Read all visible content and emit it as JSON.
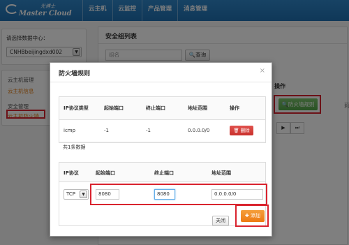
{
  "brand": {
    "cn": "光博士",
    "en": "Master Cloud"
  },
  "nav": [
    "云主机",
    "云监控",
    "产品管理",
    "消息管理"
  ],
  "sidebar": {
    "dc_label": "请选择数据中心：",
    "dc_value": "CNHBbeijingdxd002",
    "groups": [
      {
        "head": "云主机管理",
        "item": "云主机信息"
      },
      {
        "head": "安全管理",
        "item": "云主机防火墙"
      }
    ]
  },
  "main": {
    "title": "安全组列表",
    "search_placeholder": "组名",
    "search_button": "查询",
    "op_header": "操作",
    "firewall_button": "防火墙规则",
    "more_glyph": "莉",
    "pager": [
      "▶",
      "⏭"
    ]
  },
  "modal": {
    "title": "防火墙规则",
    "close_glyph": "×",
    "columns": [
      "IP协议类型",
      "起始端口",
      "终止端口",
      "地址范围",
      "操作"
    ],
    "rows": [
      {
        "protocol": "icmp",
        "start": "-1",
        "end": "-1",
        "range": "0.0.0.0/0",
        "action": "删除"
      }
    ],
    "count_text": "共1条数据",
    "add_columns": [
      "IP协议",
      "起始端口",
      "终止端口",
      "地址范围"
    ],
    "add_form": {
      "protocol": "TCP",
      "start": "8080",
      "end": "8080",
      "range": "0.0.0.0/0"
    },
    "close_button": "关闭",
    "add_button": "添加"
  }
}
